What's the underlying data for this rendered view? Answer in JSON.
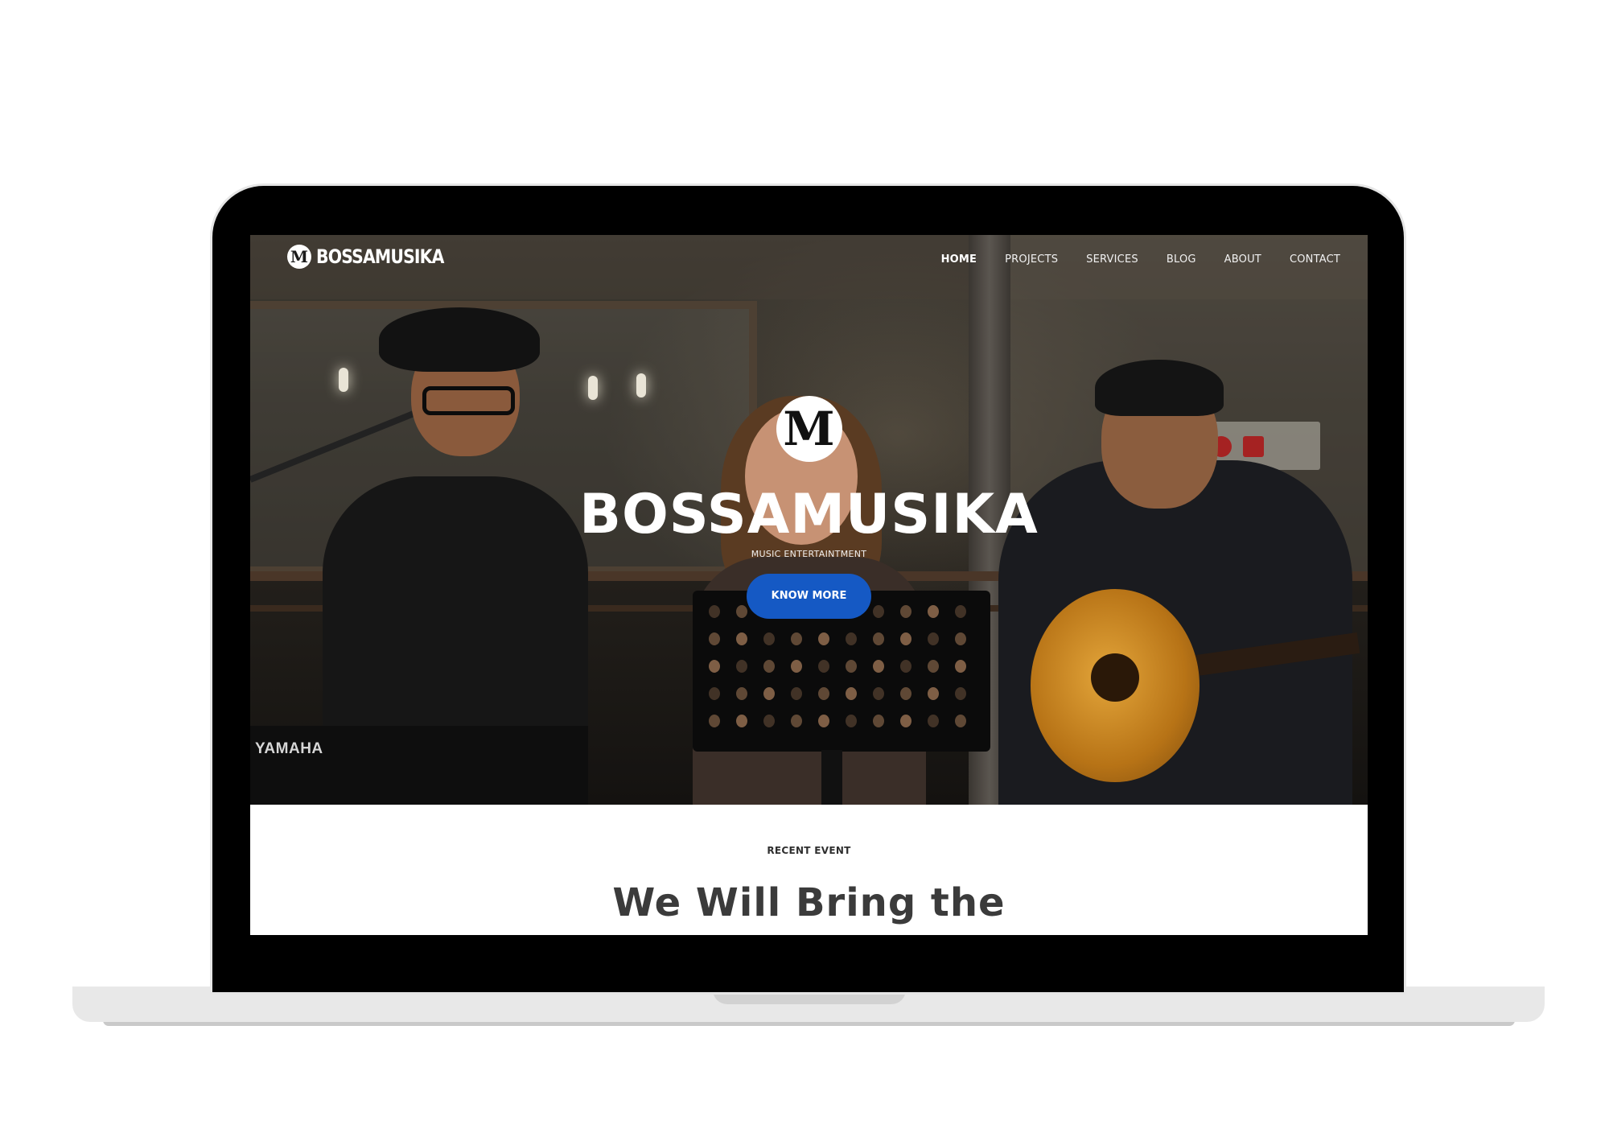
{
  "brand": {
    "logo_mark": "M",
    "name": "BOSSAMUSIKA"
  },
  "nav": {
    "items": [
      {
        "label": "HOME",
        "active": true
      },
      {
        "label": "PROJECTS",
        "active": false
      },
      {
        "label": "SERVICES",
        "active": false
      },
      {
        "label": "BLOG",
        "active": false
      },
      {
        "label": "ABOUT",
        "active": false
      },
      {
        "label": "CONTACT",
        "active": false
      }
    ]
  },
  "hero": {
    "mark": "M",
    "title": "BOSSAMUSIKA",
    "subtitle": "MUSIC ENTERTAINTMENT",
    "button_label": "KNOW MORE",
    "photo_text": "YAMAHA"
  },
  "section": {
    "eyebrow": "RECENT EVENT",
    "title": "We Will Bring the"
  },
  "colors": {
    "button": "#1559c4",
    "title_dark": "#3b3b3b"
  }
}
